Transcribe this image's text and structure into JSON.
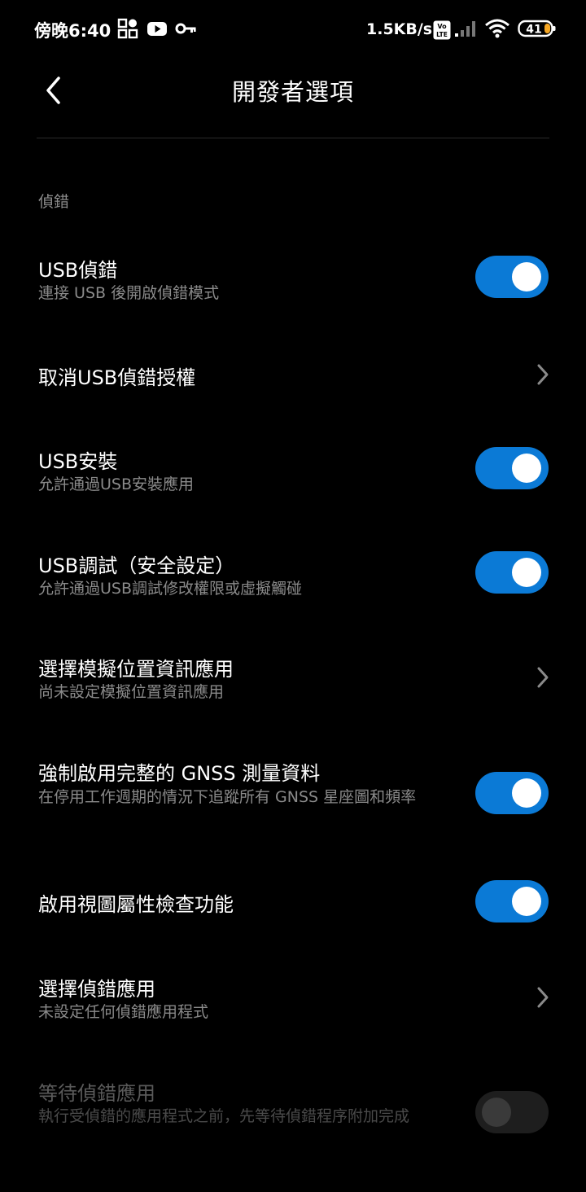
{
  "status_bar": {
    "time": "傍晚6:40",
    "network_speed": "1.5KB/s",
    "battery": "41",
    "icons": [
      "qr-scan-icon",
      "youtube-icon",
      "vpn-key-icon",
      "volte-icon",
      "signal-icon",
      "wifi-icon",
      "battery-icon"
    ]
  },
  "header": {
    "title": "開發者選項",
    "back_icon": "back-arrow-icon"
  },
  "section": {
    "label": "偵錯"
  },
  "rows": [
    {
      "title": "USB偵錯",
      "subtitle": "連接 USB 後開啟偵錯模式",
      "control": "toggle",
      "on": true
    },
    {
      "title": "取消USB偵錯授權",
      "subtitle": "",
      "control": "chevron"
    },
    {
      "title": "USB安裝",
      "subtitle": "允許通過USB安裝應用",
      "control": "toggle",
      "on": true
    },
    {
      "title": "USB調試（安全設定）",
      "subtitle": "允許通過USB調試修改權限或虛擬觸碰",
      "control": "toggle",
      "on": true
    },
    {
      "title": "選擇模擬位置資訊應用",
      "subtitle": "尚未設定模擬位置資訊應用",
      "control": "chevron"
    },
    {
      "title": "強制啟用完整的 GNSS 測量資料",
      "subtitle": "在停用工作週期的情況下追蹤所有 GNSS 星座圖和頻率",
      "control": "toggle",
      "on": true
    },
    {
      "title": "啟用視圖屬性檢查功能",
      "subtitle": "",
      "control": "toggle",
      "on": true
    },
    {
      "title": "選擇偵錯應用",
      "subtitle": "未設定任何偵錯應用程式",
      "control": "chevron"
    },
    {
      "title": "等待偵錯應用",
      "subtitle": "執行受偵錯的應用程式之前，先等待偵錯程序附加完成",
      "control": "toggle",
      "on": false,
      "disabled": true
    }
  ],
  "colors": {
    "background": "#000000",
    "accent": "#0b7ad6",
    "subtitle": "#8a8a8a"
  }
}
